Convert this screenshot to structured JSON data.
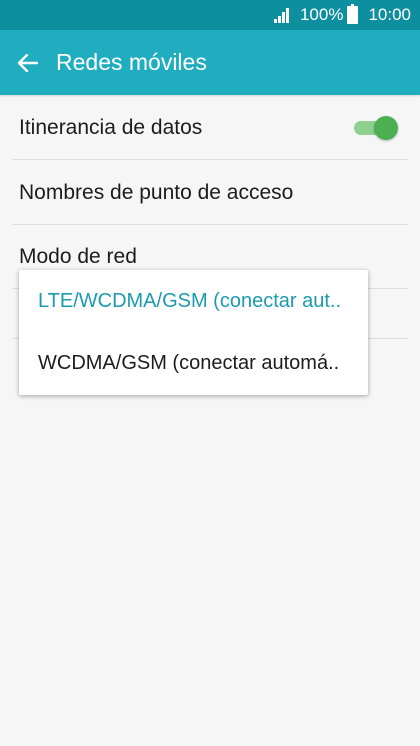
{
  "status_bar": {
    "battery_percent": "100%",
    "time": "10:00",
    "icons": [
      "signal-icon",
      "battery-icon"
    ]
  },
  "app_bar": {
    "back_icon": "back-arrow-icon",
    "title": "Redes móviles"
  },
  "settings": {
    "roaming": {
      "label": "Itinerancia de datos",
      "toggle_on": true
    },
    "apn": {
      "label": "Nombres de punto de acceso"
    },
    "network_mode": {
      "label": "Modo de red"
    }
  },
  "network_mode_dropdown": {
    "options": [
      {
        "label": "LTE/WCDMA/GSM (conectar aut..",
        "selected": true
      },
      {
        "label": "WCDMA/GSM (conectar automá..",
        "selected": false
      }
    ]
  },
  "colors": {
    "status_bar": "#0d8f9f",
    "app_bar": "#20adc0",
    "accent": "#1c9bb0",
    "toggle_on": "#4caf50"
  }
}
